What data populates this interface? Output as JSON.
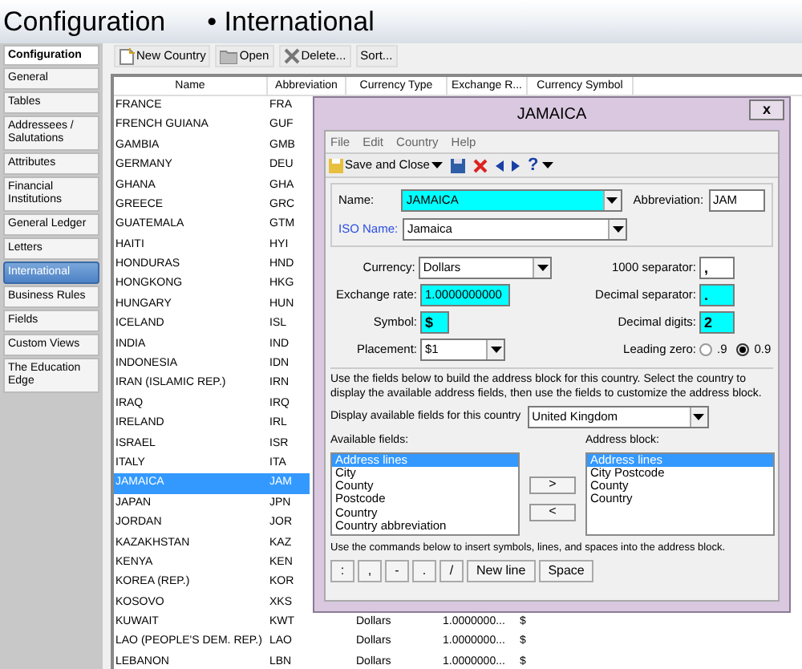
{
  "header": {
    "title": "Configuration",
    "subtitle": "• International"
  },
  "sidebar": {
    "heading": "Configuration",
    "items": [
      {
        "label": "General",
        "selected": false
      },
      {
        "label": "Tables",
        "selected": false
      },
      {
        "label": "Addressees / Salutations",
        "selected": false
      },
      {
        "label": "Attributes",
        "selected": false
      },
      {
        "label": "Financial Institutions",
        "selected": false
      },
      {
        "label": "General Ledger",
        "selected": false
      },
      {
        "label": "Letters",
        "selected": false
      },
      {
        "label": "International",
        "selected": true
      },
      {
        "label": "Business Rules",
        "selected": false
      },
      {
        "label": "Fields",
        "selected": false
      },
      {
        "label": "Custom Views",
        "selected": false
      },
      {
        "label": "The Education Edge",
        "selected": false
      }
    ]
  },
  "toolbar": [
    {
      "kind": "new",
      "label": "New Country"
    },
    {
      "kind": "open",
      "label": "Open"
    },
    {
      "kind": "delete",
      "label": "Delete..."
    },
    {
      "kind": "plain",
      "label": "Sort..."
    }
  ],
  "table": {
    "columns": [
      "Name",
      "Abbreviation",
      "Currency Type",
      "Exchange R...",
      "Currency Symbol"
    ],
    "rows": [
      {
        "name": "FRANCE",
        "abbreviation": "FRA",
        "selected": false
      },
      {
        "name": "FRENCH GUIANA",
        "abbreviation": "GUF",
        "selected": false
      },
      {
        "name": "GAMBIA",
        "abbreviation": "GMB",
        "selected": false
      },
      {
        "name": "GERMANY",
        "abbreviation": "DEU",
        "selected": false
      },
      {
        "name": "GHANA",
        "abbreviation": "GHA",
        "selected": false
      },
      {
        "name": "GREECE",
        "abbreviation": "GRC",
        "selected": false
      },
      {
        "name": "GUATEMALA",
        "abbreviation": "GTM",
        "selected": false
      },
      {
        "name": "HAITI",
        "abbreviation": "HYI",
        "selected": false
      },
      {
        "name": "HONDURAS",
        "abbreviation": "HND",
        "selected": false
      },
      {
        "name": "HONGKONG",
        "abbreviation": "HKG",
        "selected": false
      },
      {
        "name": "HUNGARY",
        "abbreviation": "HUN",
        "selected": false
      },
      {
        "name": "ICELAND",
        "abbreviation": "ISL",
        "selected": false
      },
      {
        "name": "INDIA",
        "abbreviation": "IND",
        "selected": false
      },
      {
        "name": "INDONESIA",
        "abbreviation": "IDN",
        "selected": false
      },
      {
        "name": "IRAN (ISLAMIC REP.)",
        "abbreviation": "IRN",
        "selected": false
      },
      {
        "name": "IRAQ",
        "abbreviation": "IRQ",
        "selected": false
      },
      {
        "name": "IRELAND",
        "abbreviation": "IRL",
        "selected": false
      },
      {
        "name": "ISRAEL",
        "abbreviation": "ISR",
        "selected": false
      },
      {
        "name": "ITALY",
        "abbreviation": "ITA",
        "selected": false
      },
      {
        "name": "JAMAICA",
        "abbreviation": "JAM",
        "selected": true
      },
      {
        "name": "JAPAN",
        "abbreviation": "JPN",
        "selected": false
      },
      {
        "name": "JORDAN",
        "abbreviation": "JOR",
        "selected": false
      },
      {
        "name": "KAZAKHSTAN",
        "abbreviation": "KAZ",
        "selected": false
      },
      {
        "name": "KENYA",
        "abbreviation": "KEN",
        "selected": false
      },
      {
        "name": "KOREA (REP.)",
        "abbreviation": "KOR",
        "selected": false
      },
      {
        "name": "KOSOVO",
        "abbreviation": "XKS",
        "selected": false
      },
      {
        "name": "KUWAIT",
        "abbreviation": "KWT",
        "currency_type": "Dollars",
        "exchange_rate": "1.0000000...",
        "currency_symbol": "$",
        "selected": false
      },
      {
        "name": "LAO (PEOPLE'S DEM. REP.)",
        "abbreviation": "LAO",
        "currency_type": "Dollars",
        "exchange_rate": "1.0000000...",
        "currency_symbol": "$",
        "selected": false
      },
      {
        "name": "LEBANON",
        "abbreviation": "LBN",
        "currency_type": "Dollars",
        "exchange_rate": "1.0000000...",
        "currency_symbol": "$",
        "selected": false
      }
    ]
  },
  "dialog": {
    "title": "JAMAICA",
    "close": "x",
    "menu": [
      "File",
      "Edit",
      "Country",
      "Help"
    ],
    "save_label": "Save and Close",
    "help": "?",
    "name": {
      "label": "Name:",
      "value": "JAMAICA",
      "highlighted": true
    },
    "abbreviation": {
      "label": "Abbreviation:",
      "value": "JAM"
    },
    "iso_name": {
      "label": "ISO Name:",
      "value": "Jamaica"
    },
    "left_fields": [
      {
        "kind": "dropdown",
        "label": "Currency:",
        "value": "Dollars",
        "highlighted": false
      },
      {
        "kind": "text",
        "label": "Exchange rate:",
        "value": "1.0000000000",
        "highlighted": true
      },
      {
        "kind": "text",
        "label": "Symbol:",
        "value": "$",
        "highlighted": true
      },
      {
        "kind": "dropdown",
        "label": "Placement:",
        "value": "$1",
        "highlighted": false
      }
    ],
    "right_fields": [
      {
        "kind": "text",
        "label": "1000 separator:",
        "value": ",",
        "highlighted": false
      },
      {
        "kind": "text",
        "label": "Decimal separator:",
        "value": ".",
        "highlighted": true
      },
      {
        "kind": "text",
        "label": "Decimal digits:",
        "value": "2",
        "highlighted": true
      },
      {
        "kind": "radio",
        "label": "Leading zero:",
        "options": [
          {
            "label": ".9",
            "selected": false
          },
          {
            "label": "0.9",
            "selected": true
          }
        ]
      }
    ],
    "instructions": "Use the fields below to build the address block for this country.  Select the country to display the available address fields, then use the fields to customize the address block.",
    "country_label": "Display available fields for this country",
    "country_value": "United Kingdom",
    "available_label": "Available fields:",
    "available": [
      {
        "label": "Address lines",
        "selected": true
      },
      {
        "label": "City",
        "selected": false
      },
      {
        "label": "County",
        "selected": false
      },
      {
        "label": "Postcode",
        "selected": false
      },
      {
        "label": "Country",
        "selected": false
      },
      {
        "label": "Country abbreviation",
        "selected": false
      }
    ],
    "move_buttons": [
      ">",
      "<"
    ],
    "block_label": "Address block:",
    "block": [
      {
        "label": "Address lines",
        "selected": true
      },
      {
        "label": "City Postcode",
        "selected": false
      },
      {
        "label": "County",
        "selected": false
      },
      {
        "label": "Country",
        "selected": false
      }
    ],
    "commands_text": "Use the commands below to insert symbols, lines, and spaces into the address block.",
    "commands": [
      ":",
      ",",
      "-",
      ".",
      "/",
      "New line",
      "Space"
    ]
  }
}
